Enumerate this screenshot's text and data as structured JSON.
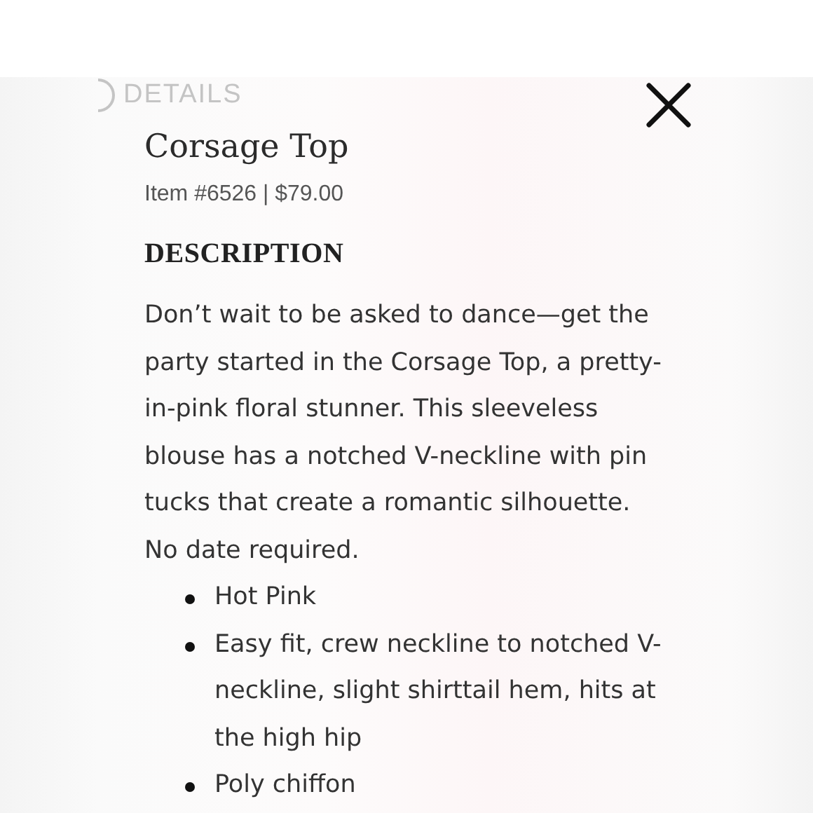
{
  "background_heading": "DETAILS",
  "product": {
    "title": "Corsage Top",
    "meta": "Item #6526 | $79.00"
  },
  "section_heading": "DESCRIPTION",
  "description": "Don’t wait to be asked to dance—get the party started in the Corsage Top, a pretty-in-pink floral stunner. This sleeveless blouse has a notched V-neckline with pin tucks that create a romantic silhouette. No date required.",
  "features": [
    "Hot Pink",
    "Easy fit, crew neckline to notched V-neckline, slight shirttail hem, hits at the high hip",
    "Poly chiffon"
  ]
}
